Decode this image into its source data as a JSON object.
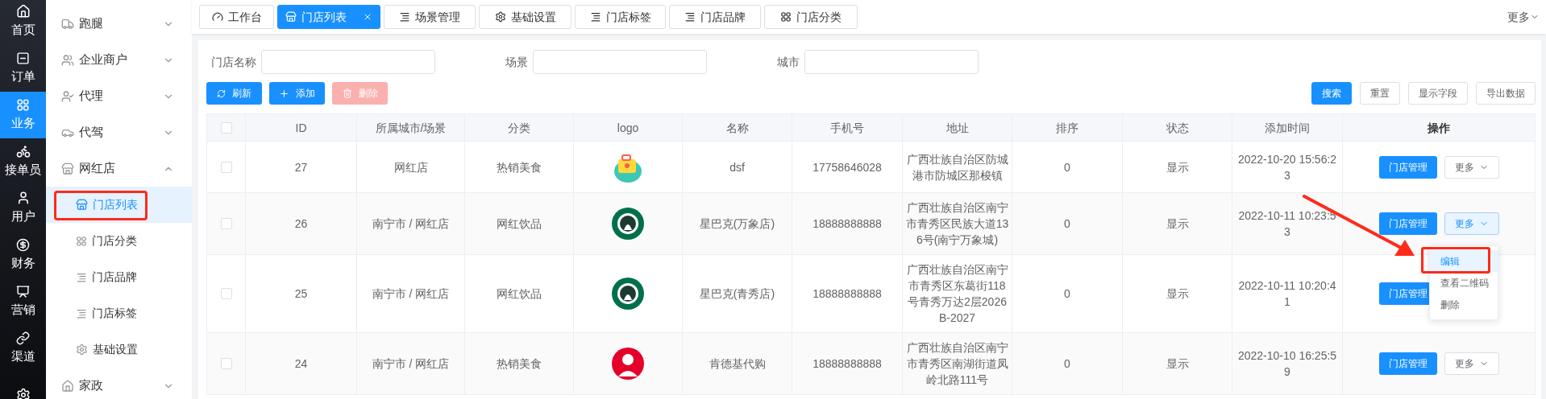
{
  "nav_rail": [
    {
      "label": "首页",
      "selected": false
    },
    {
      "label": "订单",
      "selected": false
    },
    {
      "label": "业务",
      "selected": true
    },
    {
      "label": "接单员",
      "selected": false
    },
    {
      "label": "用户",
      "selected": false
    },
    {
      "label": "财务",
      "selected": false
    },
    {
      "label": "营销",
      "selected": false
    },
    {
      "label": "渠道",
      "selected": false
    },
    {
      "selected": false
    }
  ],
  "menu": [
    {
      "label": "跑腿",
      "expanded": false
    },
    {
      "label": "企业商户",
      "expanded": false
    },
    {
      "label": "代理",
      "expanded": false
    },
    {
      "label": "代驾",
      "expanded": false
    },
    {
      "label": "网红店",
      "expanded": true,
      "children": [
        {
          "label": "门店列表",
          "selected": true
        },
        {
          "label": "门店分类",
          "selected": false
        },
        {
          "label": "门店品牌",
          "selected": false
        },
        {
          "label": "门店标签",
          "selected": false
        },
        {
          "label": "基础设置",
          "selected": false
        }
      ]
    },
    {
      "label": "家政",
      "expanded": false
    }
  ],
  "tabs": [
    {
      "label": "工作台",
      "selected": false
    },
    {
      "label": "门店列表",
      "selected": true
    },
    {
      "label": "场景管理",
      "selected": false
    },
    {
      "label": "基础设置",
      "selected": false
    },
    {
      "label": "门店标签",
      "selected": false
    },
    {
      "label": "门店品牌",
      "selected": false
    },
    {
      "label": "门店分类",
      "selected": false
    }
  ],
  "tabs_more": "更多",
  "filters": [
    {
      "label": "门店名称"
    },
    {
      "label": "场景"
    },
    {
      "label": "城市"
    }
  ],
  "left_buttons": [
    {
      "label": "刷新",
      "kind": "refresh",
      "disabled": false
    },
    {
      "label": "添加",
      "kind": "add",
      "disabled": false
    },
    {
      "label": "删除",
      "kind": "delete",
      "disabled": true
    }
  ],
  "right_buttons": [
    {
      "label": "搜索",
      "kind": "primary"
    },
    {
      "label": "重置",
      "kind": "default"
    },
    {
      "label": "显示字段",
      "kind": "default"
    },
    {
      "label": "导出数据",
      "kind": "default"
    }
  ],
  "table": {
    "header_checked": false,
    "columns": [
      "ID",
      "所属城市/场景",
      "分类",
      "logo",
      "名称",
      "手机号",
      "地址",
      "排序",
      "状态",
      "添加时间",
      "操作"
    ],
    "rows": [
      {
        "checked": false,
        "id": "27",
        "city_scene": "网红店",
        "category": "热销美食",
        "name": "dsf",
        "phone": "17758646028",
        "address": "广西壮族自治区防城港市防城区那梭镇",
        "sort": "0",
        "status": "显示",
        "added": "2022-10-20 15:56:23",
        "manage": "门店管理",
        "more": "更多",
        "more_open": false
      },
      {
        "checked": false,
        "id": "26",
        "city_scene": "南宁市 / 网红店",
        "category": "网红饮品",
        "name": "星巴克(万象店)",
        "phone": "18888888888",
        "address": "广西壮族自治区南宁市青秀区民族大道136号(南宁万象城)",
        "sort": "0",
        "status": "显示",
        "added": "2022-10-11 10:23:53",
        "manage": "门店管理",
        "more": "更多",
        "more_open": true
      },
      {
        "checked": false,
        "id": "25",
        "city_scene": "南宁市 / 网红店",
        "category": "网红饮品",
        "name": "星巴克(青秀店)",
        "phone": "18888888888",
        "address": "广西壮族自治区南宁市青秀区东葛街118号青秀万达2层2026B-2027",
        "sort": "0",
        "status": "显示",
        "added": "2022-10-11 10:20:41",
        "manage": "门店管理"
      },
      {
        "checked": false,
        "id": "24",
        "city_scene": "南宁市 / 网红店",
        "category": "热销美食",
        "name": "肯德基代购",
        "phone": "18888888888",
        "address": "广西壮族自治区南宁市青秀区南湖街道凤岭北路111号",
        "sort": "0",
        "status": "显示",
        "added": "2022-10-10 16:25:59",
        "manage": "门店管理",
        "more": "更多",
        "more_open": false
      }
    ]
  },
  "dropdown": [
    {
      "label": "编辑",
      "selected": true
    },
    {
      "label": "查看二维码",
      "selected": false
    },
    {
      "label": "删除",
      "selected": false
    }
  ]
}
